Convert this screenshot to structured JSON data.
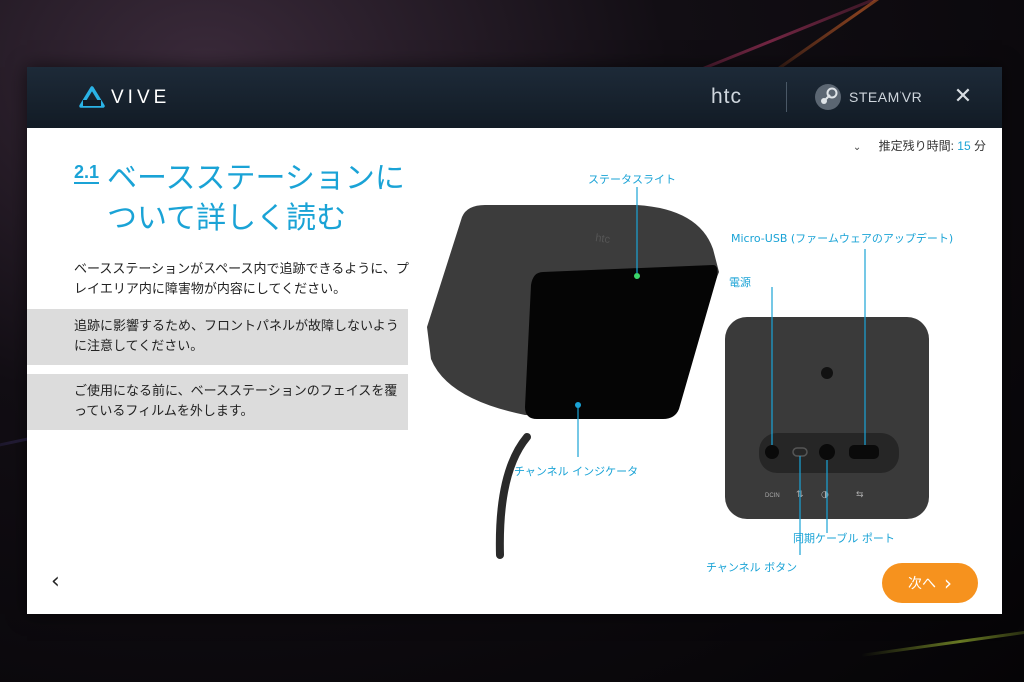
{
  "app": {
    "brand": "VIVE",
    "htc": "htc",
    "steamvr": "STEAM",
    "steamvr_suffix": "VR",
    "close_glyph": "✕"
  },
  "time_estimate": {
    "label": "推定残り時間:",
    "value": "15",
    "unit": "分"
  },
  "step": {
    "number": "2.1",
    "title": "ベースステーションについて詳しく読む"
  },
  "intro_text": "ベースステーションがスペース内で追跡できるように、プレイエリア内に障害物が内容にしてください。",
  "notices": [
    {
      "text": "追跡に影響するため、フロントパネルが故障しないように注意してください。"
    },
    {
      "text": "ご使用になる前に、ベースステーションのフェイスを覆っているフィルムを外します。"
    }
  ],
  "diagram": {
    "callouts": {
      "status_light": "ステータスライト",
      "channel_indicator": "チャンネル インジケータ",
      "micro_usb": "Micro-USB (ファームウェアのアップデート)",
      "power": "電源",
      "sync_port": "同期ケーブル ポート",
      "channel_button": "チャンネル ボタン"
    },
    "port_labels": {
      "dcin": "DCIN"
    },
    "device_logo": "htc"
  },
  "nav": {
    "back_glyph": "‹",
    "next_label": "次へ",
    "next_glyph": "›"
  },
  "colors": {
    "accent": "#1aa3d6",
    "next_button": "#f6921e",
    "status_led": "#3bd66b"
  }
}
